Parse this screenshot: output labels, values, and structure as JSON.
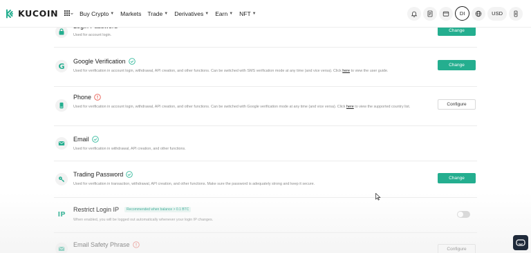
{
  "header": {
    "brand": "KUCOIN",
    "nav": [
      {
        "label": "Buy Crypto",
        "has_caret": true
      },
      {
        "label": "Markets",
        "has_caret": false
      },
      {
        "label": "Trade",
        "has_caret": true
      },
      {
        "label": "Derivatives",
        "has_caret": true
      },
      {
        "label": "Earn",
        "has_caret": true
      },
      {
        "label": "NFT",
        "has_caret": true
      }
    ],
    "avatar_initials": "DI",
    "currency": "USD"
  },
  "rows": {
    "login_password": {
      "title": "Login Password",
      "desc": "Used for account login.",
      "button": "Change"
    },
    "google": {
      "title": "Google Verification",
      "desc": "Used for verification in account login, withdrawal, API creation, and other functions. Can be switched with SMS verification mode at any time (and vice versa). Click",
      "link": "here",
      "desc_after": "to view the user guide.",
      "button": "Change"
    },
    "phone": {
      "title": "Phone",
      "desc": "Used for verification in account login, withdrawal, API creation, and other functions. Can be switched with Google verification mode at any time (and vice versa). Click",
      "link": "here",
      "desc_after": "to view the supported country list.",
      "button": "Configure"
    },
    "email": {
      "title": "Email",
      "desc": "Used for verification in withdrawal, API creation, and other functions."
    },
    "trading_password": {
      "title": "Trading Password",
      "desc": "Used for verification in transaction, withdrawal, API creation, and other functions. Make sure the password is adequately strong and keep it secure.",
      "button": "Change"
    },
    "restrict_ip": {
      "title": "Restrict Login IP",
      "badge": "Recommended when balance > 0.1 BTC",
      "desc": "When enabled, you will be logged out automatically whenever your login IP changes.",
      "icon_text": "IP",
      "toggle_on": false
    },
    "email_safety": {
      "title": "Email Safety Phrase",
      "button": "Configure"
    }
  },
  "colors": {
    "accent": "#24ae8f",
    "warning": "#e85a4f",
    "success": "#2fb89a"
  }
}
